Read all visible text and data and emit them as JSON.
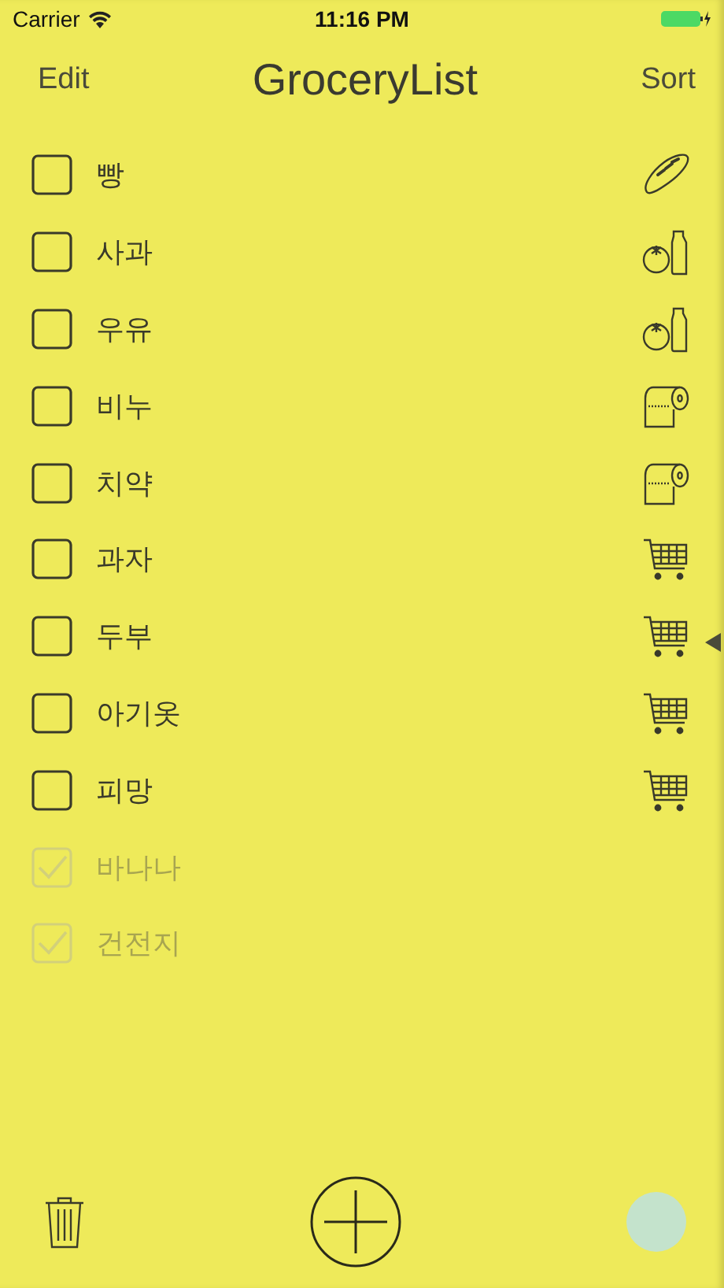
{
  "status_bar": {
    "carrier": "Carrier",
    "time": "11:16 PM"
  },
  "nav": {
    "left": "Edit",
    "title": "GroceryList",
    "right": "Sort"
  },
  "items": [
    {
      "name": "빵",
      "checked": false,
      "kind": "bread"
    },
    {
      "name": "사과",
      "checked": false,
      "kind": "produce"
    },
    {
      "name": "우유",
      "checked": false,
      "kind": "produce"
    },
    {
      "name": "비누",
      "checked": false,
      "kind": "paper"
    },
    {
      "name": "치약",
      "checked": false,
      "kind": "paper"
    },
    {
      "name": "과자",
      "checked": false,
      "kind": "cart"
    },
    {
      "name": "두부",
      "checked": false,
      "kind": "cart"
    },
    {
      "name": "아기옷",
      "checked": false,
      "kind": "cart"
    },
    {
      "name": "피망",
      "checked": false,
      "kind": "cart"
    },
    {
      "name": "바나나",
      "checked": true,
      "kind": "none"
    },
    {
      "name": "건전지",
      "checked": true,
      "kind": "none"
    }
  ]
}
